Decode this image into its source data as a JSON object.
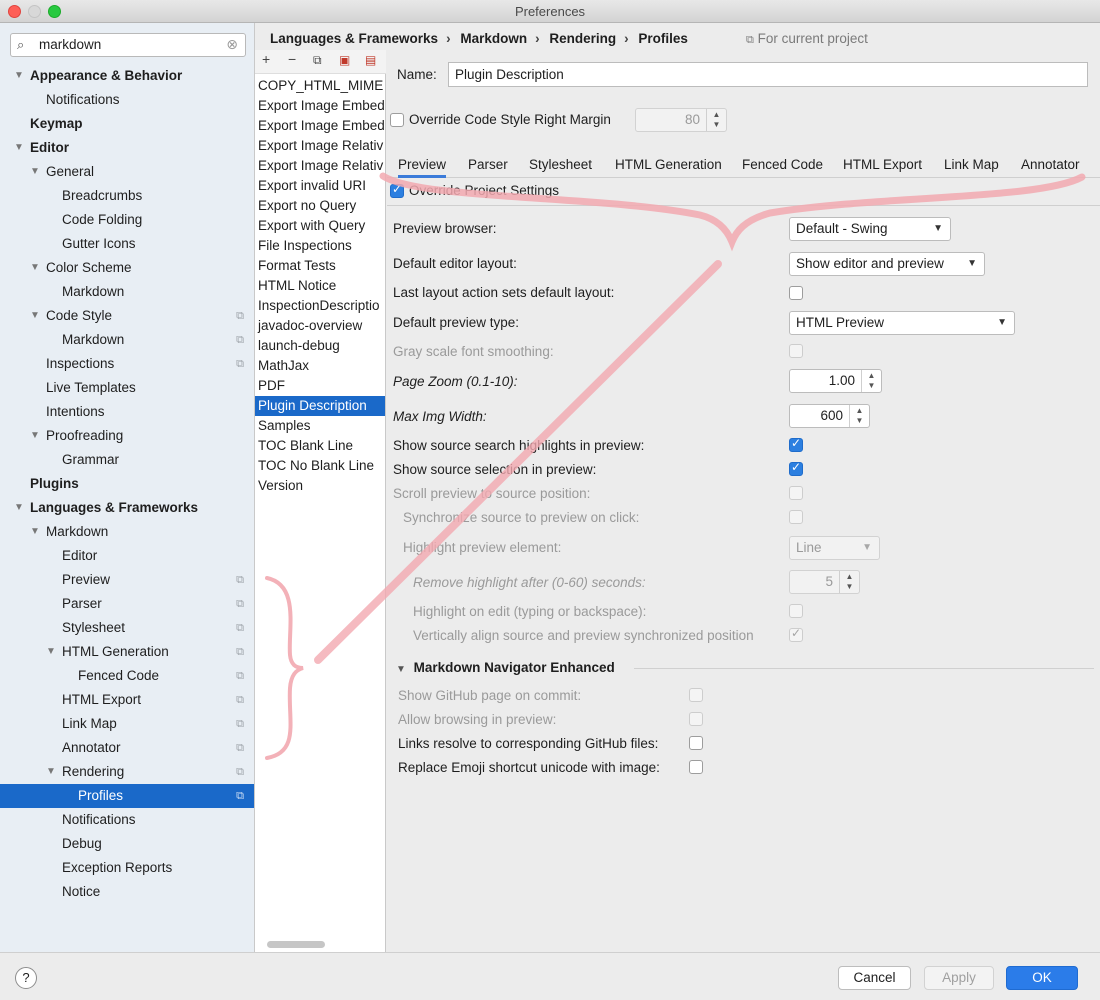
{
  "window": {
    "title": "Preferences"
  },
  "search": {
    "value": "markdown"
  },
  "tree": [
    {
      "label": "Appearance & Behavior",
      "level": 0,
      "bold": true,
      "expanded": true
    },
    {
      "label": "Notifications",
      "level": 1
    },
    {
      "label": "Keymap",
      "level": 0,
      "bold": true
    },
    {
      "label": "Editor",
      "level": 0,
      "bold": true,
      "expanded": true
    },
    {
      "label": "General",
      "level": 1,
      "expanded": true
    },
    {
      "label": "Breadcrumbs",
      "level": 2
    },
    {
      "label": "Code Folding",
      "level": 2
    },
    {
      "label": "Gutter Icons",
      "level": 2
    },
    {
      "label": "Color Scheme",
      "level": 1,
      "expanded": true
    },
    {
      "label": "Markdown",
      "level": 2
    },
    {
      "label": "Code Style",
      "level": 1,
      "expanded": true,
      "project": true
    },
    {
      "label": "Markdown",
      "level": 2,
      "project": true
    },
    {
      "label": "Inspections",
      "level": 1,
      "project": true
    },
    {
      "label": "Live Templates",
      "level": 1
    },
    {
      "label": "Intentions",
      "level": 1
    },
    {
      "label": "Proofreading",
      "level": 1,
      "expanded": true
    },
    {
      "label": "Grammar",
      "level": 2
    },
    {
      "label": "Plugins",
      "level": 0,
      "bold": true
    },
    {
      "label": "Languages & Frameworks",
      "level": 0,
      "bold": true,
      "expanded": true
    },
    {
      "label": "Markdown",
      "level": 1,
      "expanded": true
    },
    {
      "label": "Editor",
      "level": 2
    },
    {
      "label": "Preview",
      "level": 2,
      "project": true
    },
    {
      "label": "Parser",
      "level": 2,
      "project": true
    },
    {
      "label": "Stylesheet",
      "level": 2,
      "project": true
    },
    {
      "label": "HTML Generation",
      "level": 2,
      "expanded": true,
      "project": true
    },
    {
      "label": "Fenced Code",
      "level": 3,
      "project": true
    },
    {
      "label": "HTML Export",
      "level": 2,
      "project": true
    },
    {
      "label": "Link Map",
      "level": 2,
      "project": true
    },
    {
      "label": "Annotator",
      "level": 2,
      "project": true
    },
    {
      "label": "Rendering",
      "level": 2,
      "expanded": true,
      "project": true
    },
    {
      "label": "Profiles",
      "level": 3,
      "project": true,
      "selected": true
    },
    {
      "label": "Notifications",
      "level": 2
    },
    {
      "label": "Debug",
      "level": 2
    },
    {
      "label": "Exception Reports",
      "level": 2
    },
    {
      "label": "Notice",
      "level": 2
    }
  ],
  "breadcrumb": [
    "Languages & Frameworks",
    "Markdown",
    "Rendering",
    "Profiles"
  ],
  "for_current_project": "For current project",
  "profiles": [
    "COPY_HTML_MIME",
    "Export Image Embed",
    "Export Image Embed",
    "Export Image Relativ",
    "Export Image Relativ",
    "Export invalid URI",
    "Export no Query",
    "Export with Query",
    "File Inspections",
    "Format Tests",
    "HTML Notice",
    "InspectionDescriptio",
    "javadoc-overview",
    "launch-debug",
    "MathJax",
    "PDF",
    "Plugin Description",
    "Samples",
    "TOC Blank Line",
    "TOC No Blank Line",
    "Version"
  ],
  "selected_profile_index": 16,
  "name": {
    "label": "Name:",
    "value": "Plugin Description"
  },
  "override_margin": {
    "label": "Override Code Style Right Margin",
    "checked": false,
    "value": "80"
  },
  "tabs": [
    "Preview",
    "Parser",
    "Stylesheet",
    "HTML Generation",
    "Fenced Code",
    "HTML Export",
    "Link Map",
    "Annotator"
  ],
  "active_tab": "Preview",
  "override_project": {
    "label": "Override Project Settings",
    "checked": true
  },
  "preview": {
    "browser_label": "Preview browser:",
    "browser_value": "Default - Swing",
    "layout_label": "Default editor layout:",
    "layout_value": "Show editor and preview",
    "last_action_label": "Last layout action sets default layout:",
    "preview_type_label": "Default preview type:",
    "preview_type_value": "HTML Preview",
    "gray_label": "Gray scale font smoothing:",
    "zoom_label": "Page Zoom (0.1-10):",
    "zoom_value": "1.00",
    "max_img_label": "Max Img Width:",
    "max_img_value": "600",
    "search_hl_label": "Show source search highlights in preview:",
    "selection_label": "Show source selection in preview:",
    "scroll_label": "Scroll preview to source position:",
    "sync_label": "Synchronize source to preview on click:",
    "highlight_label": "Highlight preview element:",
    "highlight_value": "Line",
    "remove_label": "Remove highlight after (0-60) seconds:",
    "remove_value": "5",
    "hl_edit_label": "Highlight on edit (typing or backspace):",
    "valign_label": "Vertically align source and preview synchronized position"
  },
  "enhanced": {
    "title": "Markdown Navigator Enhanced",
    "github_commit": "Show GitHub page on commit:",
    "allow_browse": "Allow browsing in preview:",
    "links_resolve": "Links resolve to corresponding GitHub files:",
    "emoji": "Replace Emoji shortcut unicode with image:"
  },
  "buttons": {
    "cancel": "Cancel",
    "apply": "Apply",
    "ok": "OK",
    "help": "?"
  },
  "colors": {
    "accent": "#1a69c9",
    "annotation": "#f0a0a8"
  }
}
